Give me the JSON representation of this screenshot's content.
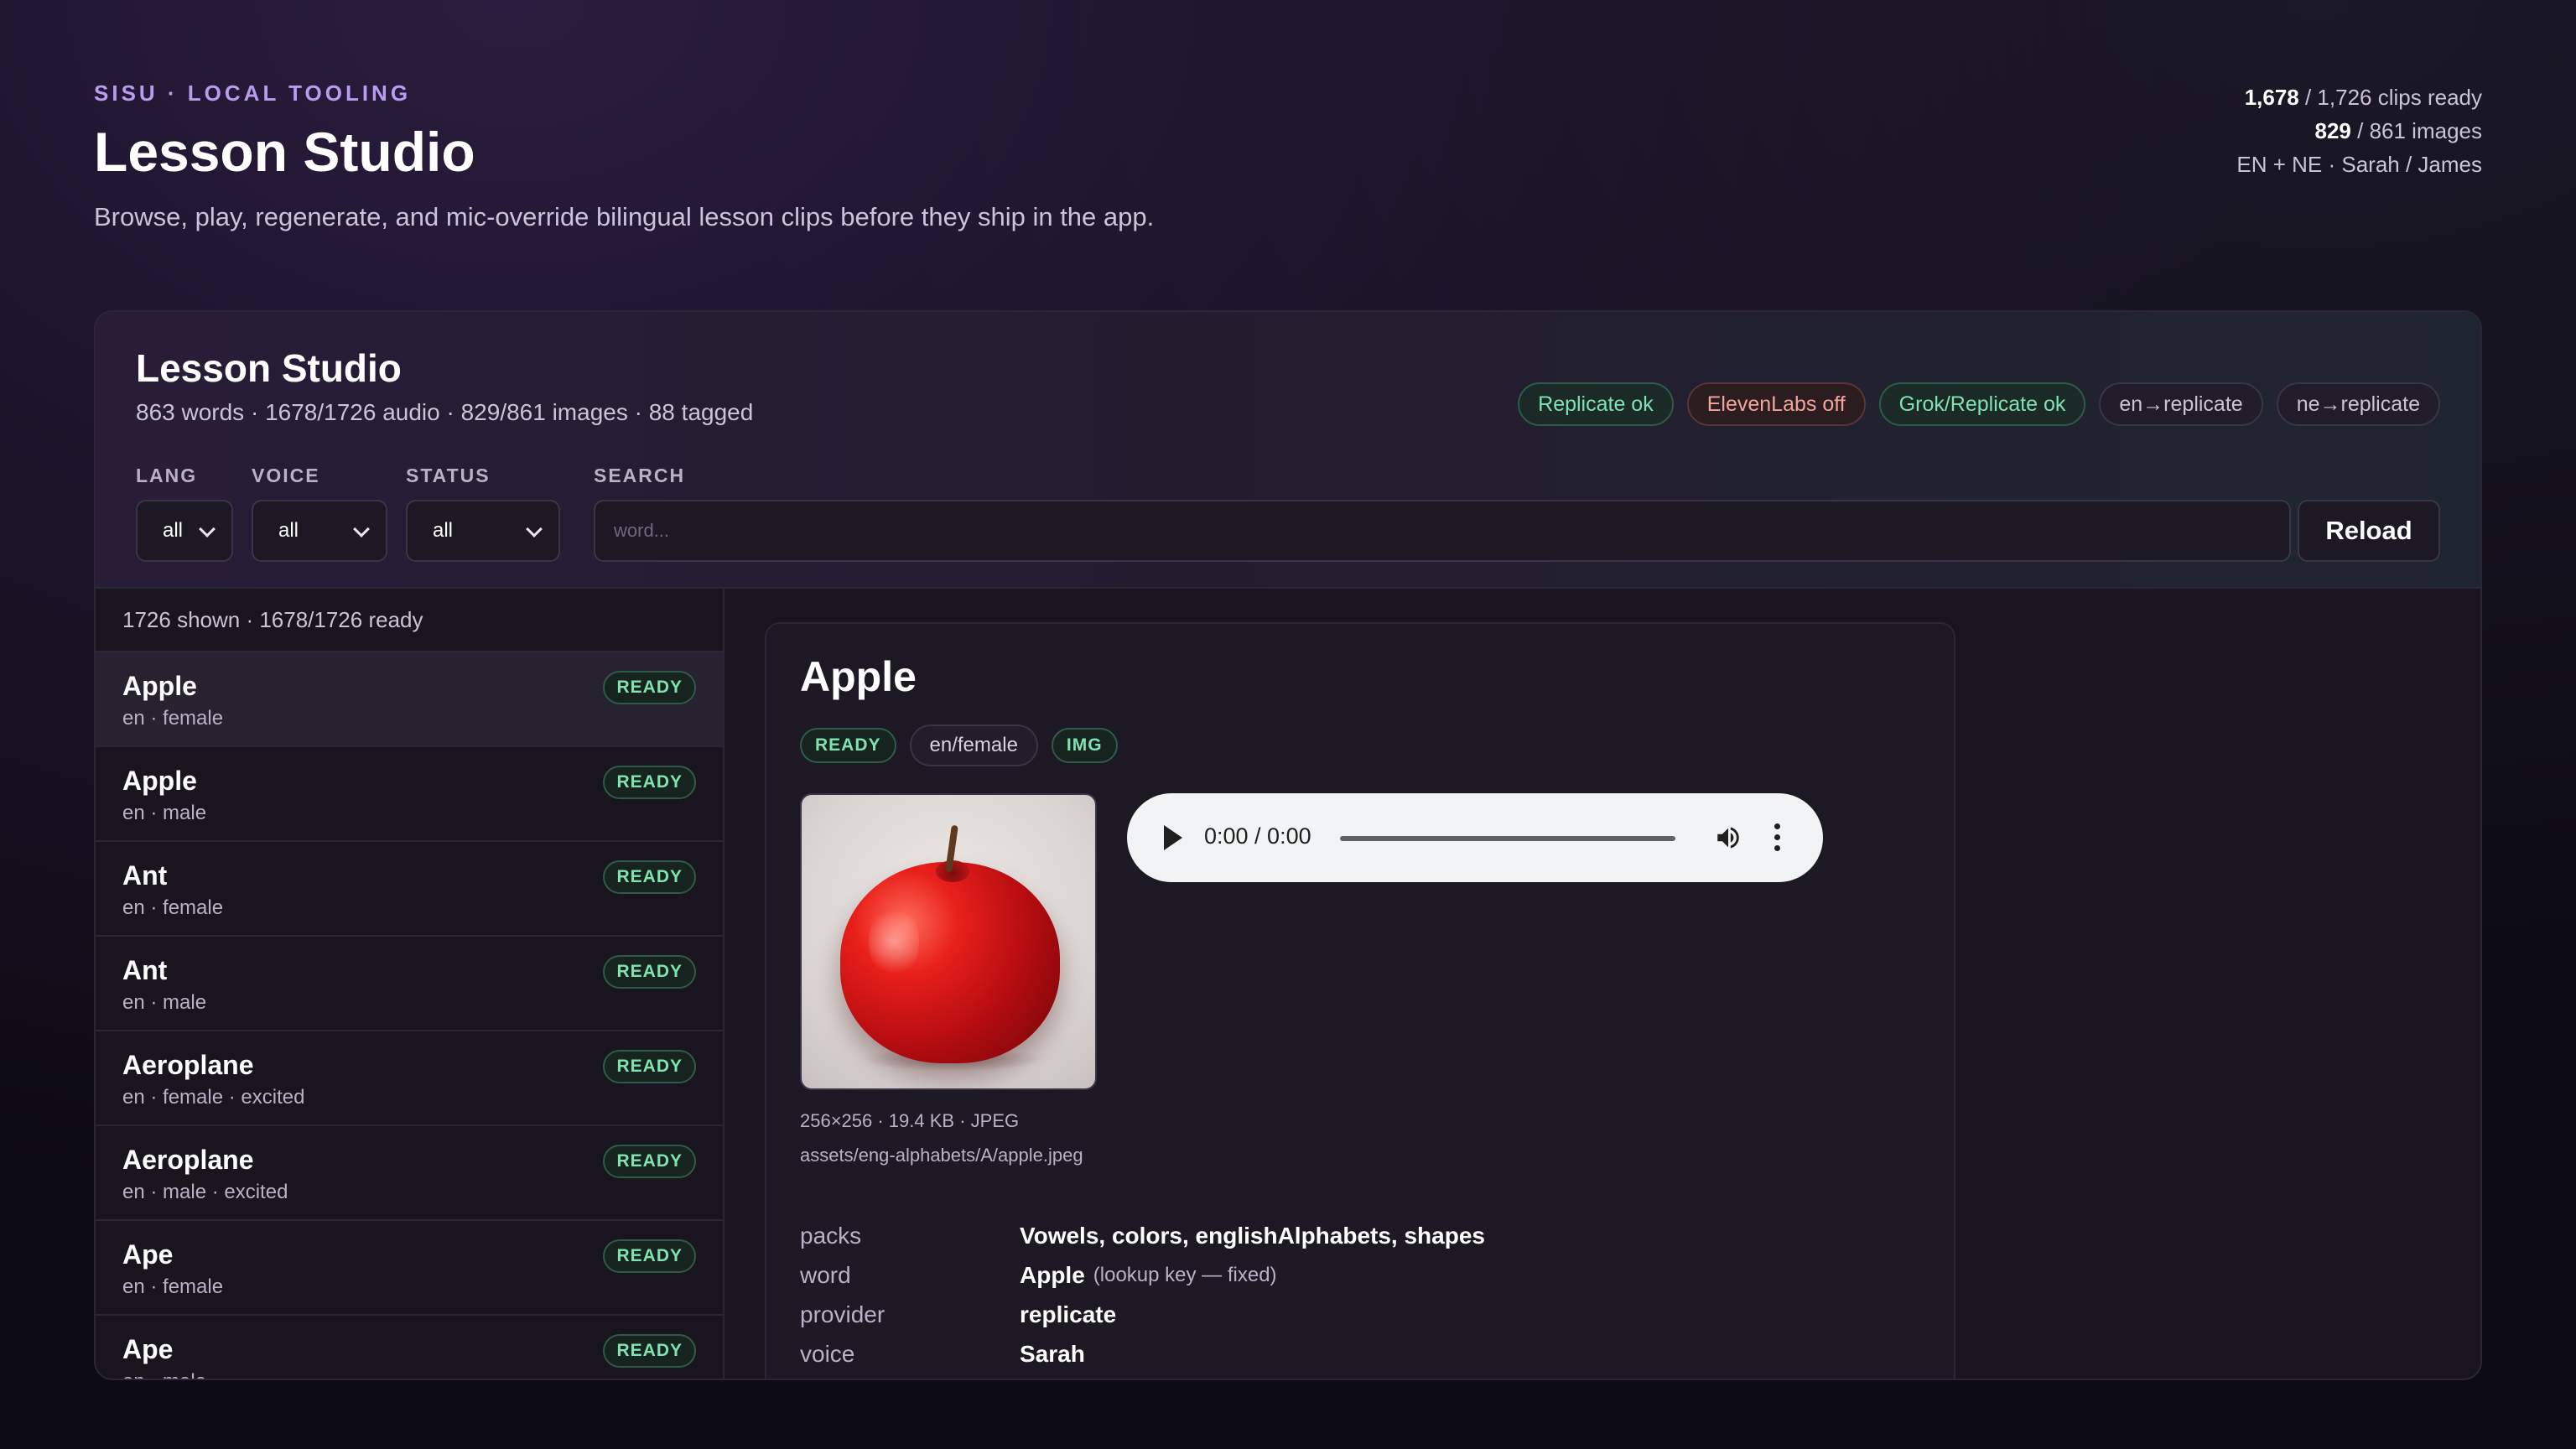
{
  "header": {
    "eyebrow": "SISU · LOCAL TOOLING",
    "title": "Lesson Studio",
    "subtitle": "Browse, play, regenerate, and mic-override bilingual lesson clips before they ship in the app."
  },
  "stats": {
    "clips_ready": "1,678",
    "clips_total": " / 1,726 clips ready",
    "images_ready": "829",
    "images_total": " / 861 images",
    "langs_voices": "EN + NE · Sarah / James"
  },
  "card": {
    "title": "Lesson Studio",
    "meta": "863 words · 1678/1726 audio · 829/861 images · 88 tagged",
    "pills": [
      {
        "label": "Replicate ok",
        "status": "ok"
      },
      {
        "label": "ElevenLabs off",
        "status": "off"
      },
      {
        "label": "Grok/Replicate ok",
        "status": "ok"
      },
      {
        "label": "en→replicate",
        "status": "neutral"
      },
      {
        "label": "ne→replicate",
        "status": "neutral"
      }
    ],
    "filters": {
      "lang_label": "LANG",
      "lang_value": "all",
      "voice_label": "VOICE",
      "voice_value": "all",
      "status_label": "STATUS",
      "status_value": "all",
      "search_label": "SEARCH",
      "search_placeholder": "word..."
    },
    "reload_label": "Reload"
  },
  "list": {
    "count": "1726 shown · 1678/1726 ready",
    "items": [
      {
        "word": "Apple",
        "sub": "en · female",
        "status": "READY"
      },
      {
        "word": "Apple",
        "sub": "en · male",
        "status": "READY"
      },
      {
        "word": "Ant",
        "sub": "en · female",
        "status": "READY"
      },
      {
        "word": "Ant",
        "sub": "en · male",
        "status": "READY"
      },
      {
        "word": "Aeroplane",
        "sub": "en · female · excited",
        "status": "READY"
      },
      {
        "word": "Aeroplane",
        "sub": "en · male · excited",
        "status": "READY"
      },
      {
        "word": "Ape",
        "sub": "en · female",
        "status": "READY"
      },
      {
        "word": "Ape",
        "sub": "en · male",
        "status": "READY"
      }
    ]
  },
  "detail": {
    "title": "Apple",
    "tags": [
      "READY",
      "en/female",
      "IMG"
    ],
    "image_meta": "256×256 · 19.4 KB · JPEG",
    "image_path": "assets/eng-alphabets/A/apple.jpeg",
    "player_time": "0:00 / 0:00",
    "fields": {
      "packs_key": "packs",
      "packs_val": "Vowels, colors, englishAlphabets, shapes",
      "word_key": "word",
      "word_val": "Apple",
      "word_note": "(lookup key — fixed)",
      "provider_key": "provider",
      "provider_val": "replicate",
      "voice_key": "voice",
      "voice_val": "Sarah"
    }
  }
}
